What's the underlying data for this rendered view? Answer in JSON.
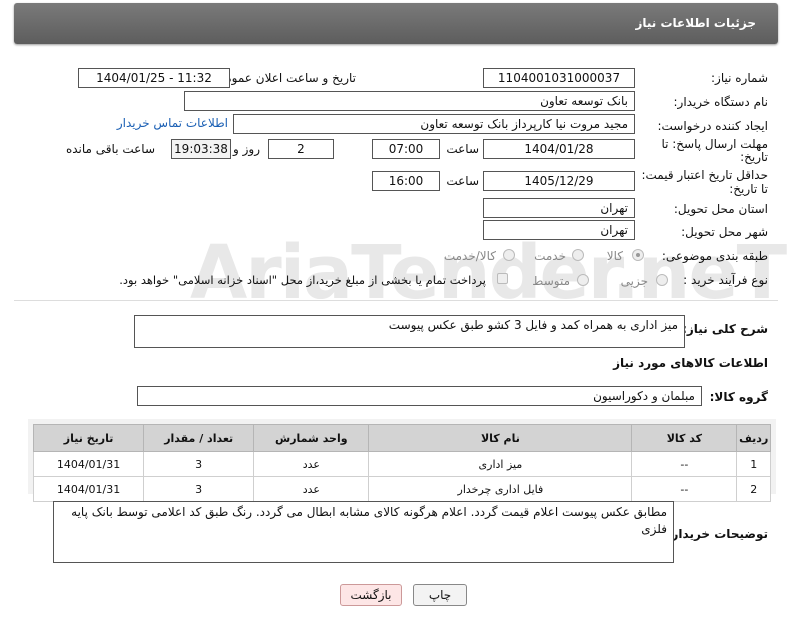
{
  "header": {
    "title": "جزئیات اطلاعات نیاز"
  },
  "watermark": "AriaTender.neT",
  "form": {
    "need_number_label": "شماره نیاز:",
    "need_number": "1104001031000037",
    "announce_label": "تاریخ و ساعت اعلان عمومی:",
    "announce_value": "1404/01/25 - 11:32",
    "buyer_org_label": "نام دستگاه خریدار:",
    "buyer_org": "بانک توسعه تعاون",
    "requester_label": "ایجاد کننده درخواست:",
    "requester": "مجید مروت نیا کارپرداز بانک توسعه تعاون",
    "buyer_contact_link": "اطلاعات تماس خریدار",
    "deadline_label_1": "مهلت ارسال پاسخ: تا",
    "deadline_label_2": "تاریخ:",
    "deadline_date": "1404/01/28",
    "hour_label": "ساعت",
    "deadline_time": "07:00",
    "days_value": "2",
    "days_label": "روز و",
    "remaining_time": "19:03:38",
    "remaining_label": "ساعت باقی مانده",
    "validity_label_1": "حداقل تاریخ اعتبار قیمت:",
    "validity_label_2": "تا تاریخ:",
    "validity_date": "1405/12/29",
    "validity_time": "16:00",
    "province_label": "استان محل تحویل:",
    "province": "تهران",
    "city_label": "شهر محل تحویل:",
    "city": "تهران",
    "category_label": "طبقه بندی موضوعی:",
    "category_options": [
      "کالا",
      "خدمت",
      "کالا/خدمت"
    ],
    "category_selected": "کالا",
    "process_label": "نوع فرآیند خرید :",
    "process_options": [
      "جزیی",
      "متوسط"
    ],
    "payment_note": "پرداخت تمام یا بخشی از مبلغ خرید،از محل \"اسناد خزانه اسلامی\" خواهد بود.",
    "description_label": "شرح کلی نیاز:",
    "description": "میز اداری به همراه کمد و فایل 3 کشو طبق عکس پیوست"
  },
  "goods": {
    "section_title": "اطلاعات کالاهای مورد نیاز",
    "group_label": "گروه کالا:",
    "group_value": "مبلمان و دکوراسیون",
    "columns": [
      "ردیف",
      "کد کالا",
      "نام کالا",
      "واحد شمارش",
      "تعداد / مقدار",
      "تاریخ نیاز"
    ],
    "rows": [
      [
        "1",
        "--",
        "میز اداری",
        "عدد",
        "3",
        "1404/01/31"
      ],
      [
        "2",
        "--",
        "فایل اداری چرخدار",
        "عدد",
        "3",
        "1404/01/31"
      ]
    ]
  },
  "buyer_notes": {
    "label": "توضیحات خریدار:",
    "text": "مطابق عکس پیوست اعلام قیمت گردد. اعلام هرگونه کالای مشابه ابطال می گردد. رنگ طبق کد اعلامی توسط بانک پایه فلزی"
  },
  "buttons": {
    "print": "چاپ",
    "back": "بازگشت"
  }
}
